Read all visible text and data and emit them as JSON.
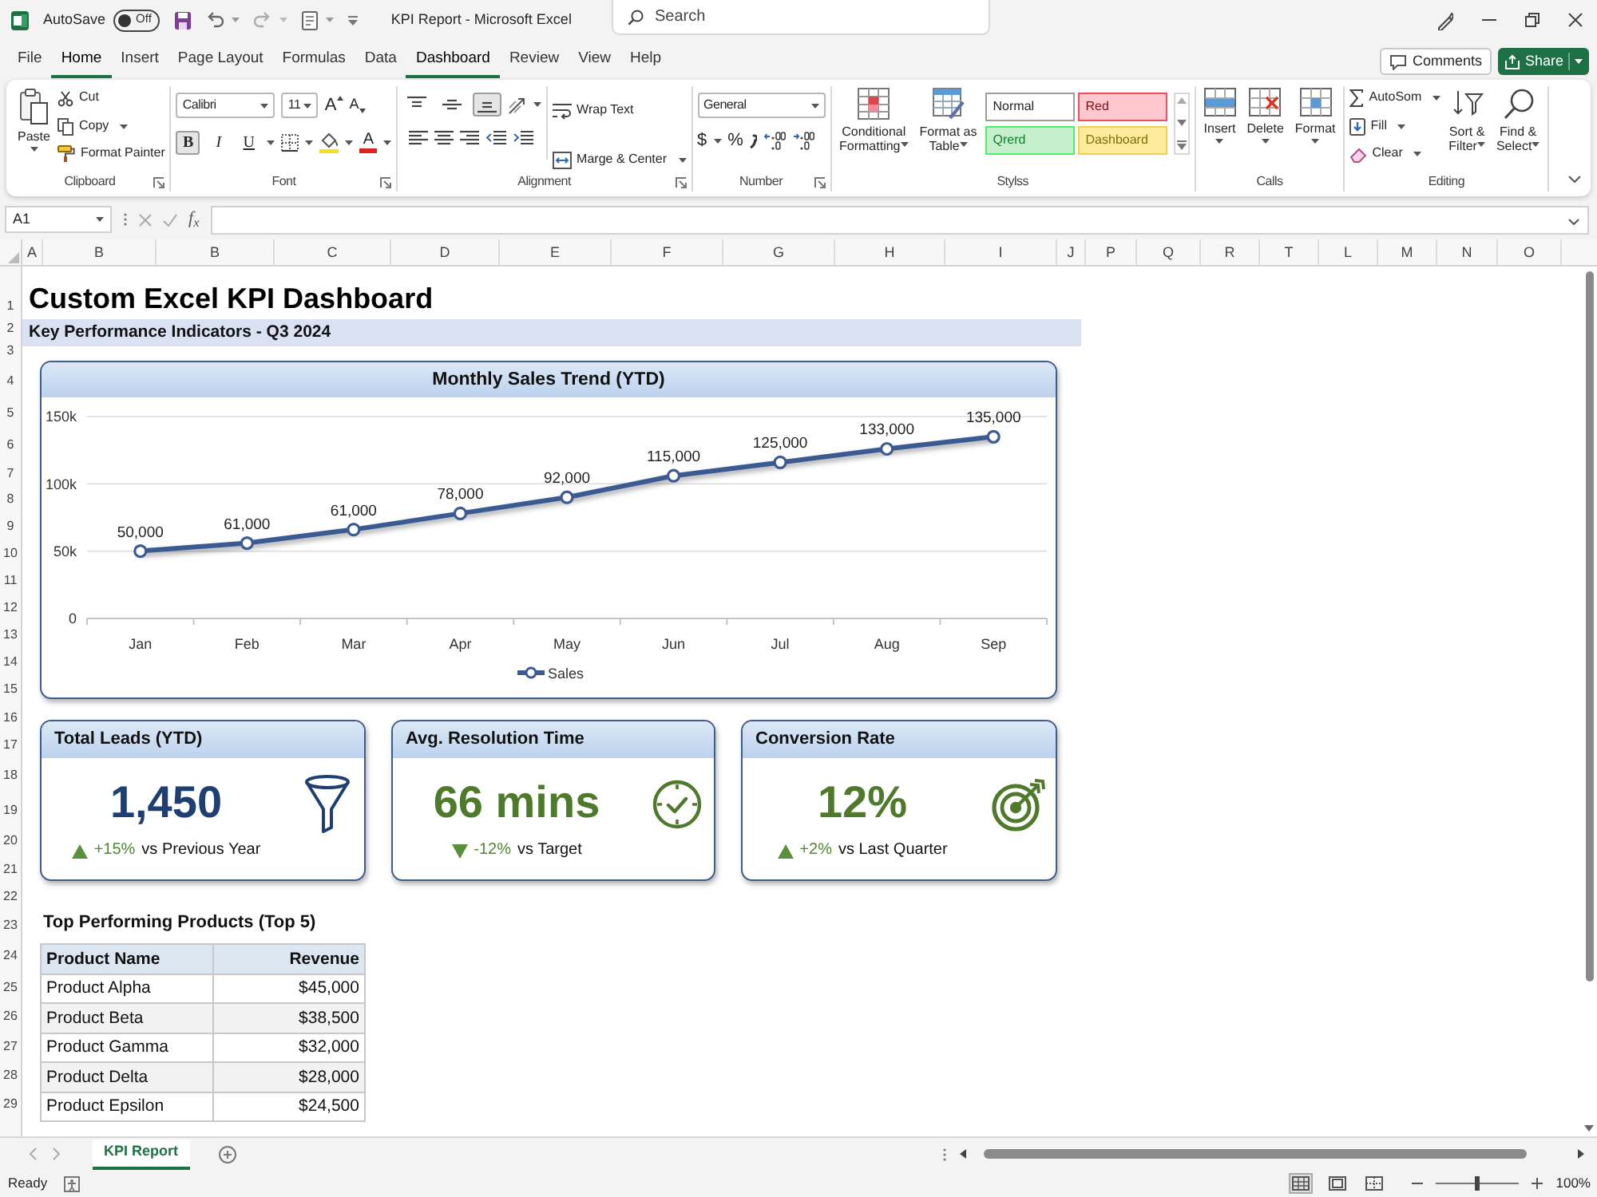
{
  "title_bar": {
    "autosave": {
      "label": "AutoSave",
      "toggle": {
        "label": "Off",
        "on": false
      }
    },
    "title": "KPI Report - Microsoft Excel",
    "search": {
      "placeholder": "Search"
    }
  },
  "tabs": [
    {
      "label": "File",
      "selected": false
    },
    {
      "label": "Home",
      "selected": true
    },
    {
      "label": "Insert",
      "selected": false
    },
    {
      "label": "Page Layout",
      "selected": false
    },
    {
      "label": "Formulas",
      "selected": false
    },
    {
      "label": "Data",
      "selected": false
    },
    {
      "label": "Dashboard",
      "selected": true
    },
    {
      "label": "Review",
      "selected": false
    },
    {
      "label": "View",
      "selected": false
    },
    {
      "label": "Help",
      "selected": false
    }
  ],
  "header_buttons": {
    "comments": "Comments",
    "share": "Share"
  },
  "ribbon": [
    {
      "label": "Clipboard",
      "large": [
        "Paste"
      ],
      "small": [
        "Cut",
        "Copy",
        "Format Painter"
      ]
    },
    {
      "label": "Font",
      "font": "Calibri",
      "size": "11",
      "grow": "A",
      "shrink": "A",
      "styles": [
        {
          "label": "B",
          "selected": true
        },
        {
          "label": "I",
          "selected": false
        },
        {
          "label": "U",
          "selected": false
        }
      ],
      "font_color": "A"
    },
    {
      "label": "Alignment",
      "vertical": [
        {
          "selected": false
        },
        {
          "selected": false
        },
        {
          "selected": true
        }
      ],
      "wrap": "Wrap Text",
      "merge": "Marge & Center"
    },
    {
      "label": "Number",
      "format": "General",
      "currency": "$",
      "percent": "%"
    },
    {
      "label": "Stylss",
      "large": [
        "Conditional Formatting",
        "Format as Table"
      ],
      "styles": [
        {
          "label": "Normal",
          "color": "#ffffff"
        },
        {
          "label": "Red",
          "color": "#ffc7ce"
        },
        {
          "label": "Qrerd",
          "color": "#c6efce"
        },
        {
          "label": "Dashboard",
          "color": "#ffeb9c"
        }
      ]
    },
    {
      "label": "Calls",
      "large": [
        "Insert",
        "Delete",
        "Format"
      ]
    },
    {
      "label": "Editing",
      "small": [
        "AutoSom",
        "Fill",
        "Clear"
      ],
      "large": [
        "Sort & Filter",
        "Find & Select"
      ]
    }
  ],
  "formula_bar": {
    "name_box": "A1",
    "function_label": "f$_{x}$"
  },
  "sheet": {
    "columns": [
      "A",
      "B",
      "B",
      "C",
      "D",
      "E",
      "F",
      "G",
      "H",
      "I",
      "J",
      "P",
      "Q",
      "R",
      "T",
      "L",
      "M",
      "N",
      "O"
    ],
    "rows": [
      "1",
      "2",
      "3",
      "4",
      "5",
      "6",
      "7",
      "8",
      "9",
      "10",
      "11",
      "12",
      "13",
      "14",
      "15",
      "16",
      "17",
      "18",
      "19",
      "20",
      "21",
      "22",
      "23",
      "24",
      "25",
      "26",
      "27",
      "28",
      "29"
    ],
    "title": "Custom Excel KPI Dashboard",
    "subtitle": "Key Performance Indicators - Q3 2024"
  },
  "chart": {
    "chart_data": {
      "type": "line",
      "title": "Monthly Sales Trend (YTD)",
      "categories": [
        "Jan",
        "Feb",
        "Mar",
        "Apr",
        "May",
        "Jun",
        "Jul",
        "Aug",
        "Sep"
      ],
      "series": [
        {
          "name": "Sales",
          "color": "#3b5a92",
          "marker": "circle",
          "values": [
            50000,
            56000,
            66000,
            78000,
            90000,
            106000,
            116000,
            126000,
            135000
          ]
        }
      ],
      "ylim": [
        0,
        150000
      ],
      "yticks": [
        {
          "value": 0,
          "label": "0"
        },
        {
          "value": 50000,
          "label": "50k"
        },
        {
          "value": 100000,
          "label": "100k"
        },
        {
          "value": 150000,
          "label": "150k"
        }
      ],
      "value_labels": [
        "50,000",
        "61,000",
        "61,000",
        "78,000",
        "92,000",
        "115,000",
        "125,000",
        "133,000",
        "135,000"
      ]
    }
  },
  "kpis": [
    {
      "title": "Total Leads (YTD)",
      "value": "1,450",
      "color": "#1f3f73",
      "up": true,
      "change": "+15%",
      "comparison": "vs Previous Year"
    },
    {
      "title": "Avg. Resolution Time",
      "value": "66 mins",
      "color": "#4e7a2b",
      "up": false,
      "change": "-12%",
      "comparison": "vs Target"
    },
    {
      "title": "Conversion Rate",
      "value": "12%",
      "color": "#4e7a2b",
      "up": true,
      "change": "+2%",
      "comparison": "vs Last Quarter"
    }
  ],
  "products": {
    "title": "Top Performing Products (Top 5)",
    "columns": [
      "Product Name",
      "Revenue"
    ],
    "rows": [
      [
        "Product Alpha",
        "$45,000"
      ],
      [
        "Product Beta",
        "$38,500"
      ],
      [
        "Product Gamma",
        "$32,000"
      ],
      [
        "Product Delta",
        "$28,000"
      ],
      [
        "Product Epsilon",
        "$24,500"
      ]
    ]
  },
  "sheet_tabs": [
    {
      "label": "KPI Report",
      "selected": true
    }
  ],
  "status_bar": {
    "status": "Ready",
    "views": [
      {
        "selected": true
      },
      {
        "selected": false
      },
      {
        "selected": false
      }
    ],
    "zoom": {
      "level": 0.5,
      "reading": "100%"
    }
  }
}
